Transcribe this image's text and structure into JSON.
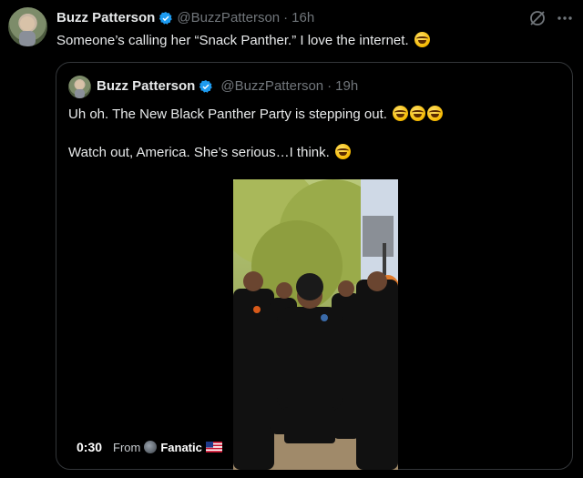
{
  "tweet": {
    "author_name": "Buzz Patterson",
    "handle": "@BuzzPatterson",
    "separator": "·",
    "time": "16h",
    "text": "Someone’s calling her “Snack Panther.” I love the internet.",
    "emoji_icon": "rolling-on-floor-laughing-emoji"
  },
  "quoted": {
    "author_name": "Buzz Patterson",
    "handle": "@BuzzPatterson",
    "separator": "·",
    "time": "19h",
    "line1": "Uh oh. The New Black Panther Party is stepping out.",
    "line2": "Watch out, America. She’s serious…I think.",
    "video": {
      "duration": "0:30",
      "from_label": "From",
      "source": "Fanatic",
      "flag_icon": "us-flag-icon"
    }
  },
  "colors": {
    "verified": "#1d9bf0",
    "muted": "#71767b",
    "text": "#e7e9ea",
    "border": "#333639"
  }
}
